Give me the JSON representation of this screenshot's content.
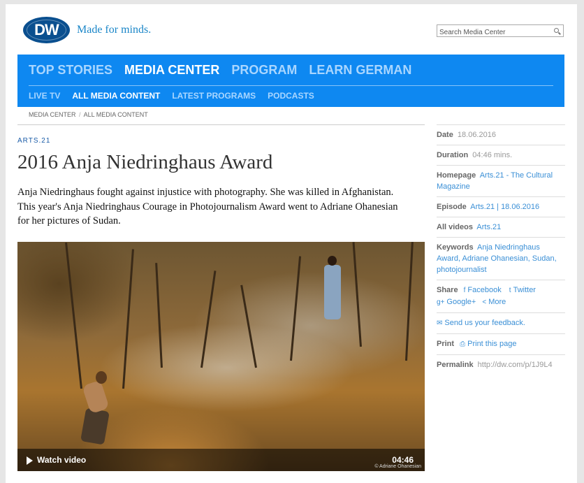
{
  "header": {
    "logo_text": "DW",
    "tagline": "Made for minds.",
    "search_placeholder": "Search Media Center"
  },
  "nav": {
    "main": [
      "TOP STORIES",
      "MEDIA CENTER",
      "PROGRAM",
      "LEARN GERMAN"
    ],
    "sub": [
      "LIVE TV",
      "ALL MEDIA CONTENT",
      "LATEST PROGRAMS",
      "PODCASTS"
    ]
  },
  "breadcrumb": {
    "first": "MEDIA CENTER",
    "separator": "/",
    "second": "ALL MEDIA CONTENT"
  },
  "article": {
    "kicker": "ARTS.21",
    "title": "2016 Anja Niedringhaus Award",
    "lead": "Anja Niedringhaus fought against injustice with photography. She was killed in Afghanistan. This year's Anja Niedringhaus Courage in Photojournalism Award went to Adriane Ohanesian for her pictures of Sudan."
  },
  "video": {
    "watch_label": "Watch video",
    "duration": "04:46",
    "credit": "© Adriane Ohanesian"
  },
  "meta": {
    "date_label": "Date",
    "date": "18.06.2016",
    "duration_label": "Duration",
    "duration": "04:46 mins.",
    "homepage_label": "Homepage",
    "homepage": "Arts.21 - The Cultural Magazine",
    "episode_label": "Episode",
    "episode": "Arts.21 | 18.06.2016",
    "allvideos_label": "All videos",
    "allvideos": "Arts.21",
    "keywords_label": "Keywords",
    "keywords": "Anja Niedringhaus Award, Adriane Ohanesian, Sudan, photojournalist",
    "share_label": "Share",
    "share_facebook": "Facebook",
    "share_twitter": "Twitter",
    "share_google": "Google+",
    "share_more": "More",
    "feedback": "Send us your feedback.",
    "print_label": "Print",
    "print_link": "Print this page",
    "permalink_label": "Permalink",
    "permalink": "http://dw.com/p/1J9L4"
  },
  "colors": {
    "brand_blue": "#0e88f1",
    "link_blue": "#3a8fd6",
    "logo_navy": "#0a4f8f"
  }
}
